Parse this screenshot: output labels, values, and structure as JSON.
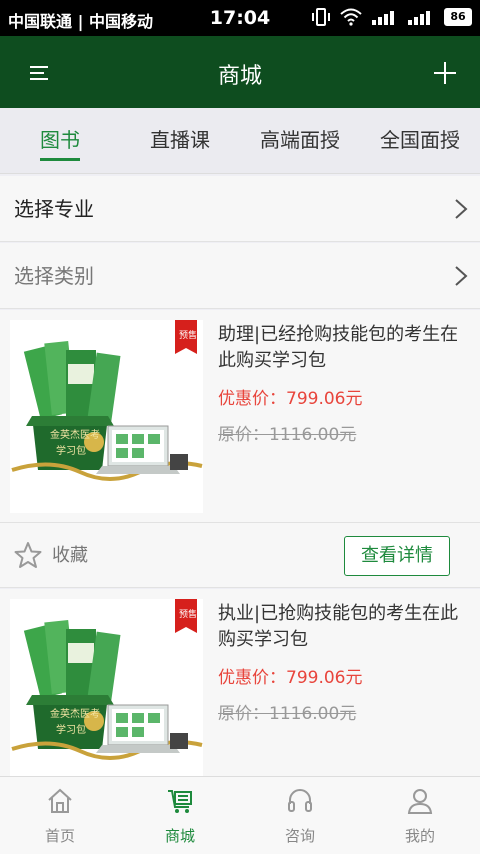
{
  "status": {
    "carrier": "中国联通 | 中国移动",
    "time": "17:04",
    "battery": "86"
  },
  "header": {
    "title": "商城"
  },
  "tabs": [
    "图书",
    "直播课",
    "高端面授",
    "全国面授"
  ],
  "filters": {
    "major": "选择专业",
    "category": "选择类别"
  },
  "products": [
    {
      "name": "助理|已经抢购技能包的考生在此购买学习包",
      "price": "优惠价：799.06元",
      "original": "原价：1116.00元",
      "badge": "预售",
      "box_text": "金英杰医考 学习包"
    },
    {
      "name": "执业|已抢购技能包的考生在此购买学习包",
      "price": "优惠价：799.06元",
      "original": "原价：1116.00元",
      "badge": "预售",
      "box_text": "金英杰医考 学习包"
    }
  ],
  "actions": {
    "favorite": "收藏",
    "details": "查看详情"
  },
  "nav": [
    {
      "label": "首页",
      "icon": "home-icon"
    },
    {
      "label": "商城",
      "icon": "shop-icon"
    },
    {
      "label": "咨询",
      "icon": "headset-icon"
    },
    {
      "label": "我的",
      "icon": "user-icon"
    }
  ],
  "colors": {
    "header": "#0e4d1f",
    "accent": "#1e8a3d",
    "price": "#e8453c"
  }
}
